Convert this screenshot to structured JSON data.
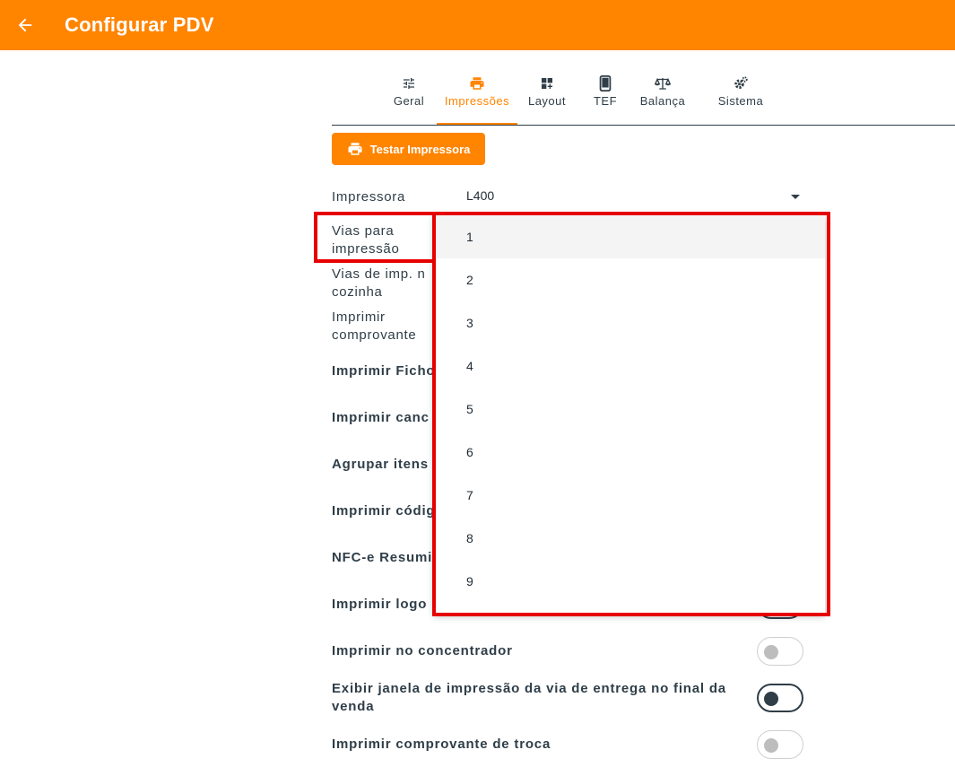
{
  "appbar": {
    "title": "Configurar PDV",
    "back_icon": "arrow-left-icon"
  },
  "tabs": [
    {
      "label": "Geral",
      "icon": "tune-icon"
    },
    {
      "label": "Impressões",
      "icon": "printer-icon",
      "active": true
    },
    {
      "label": "Layout",
      "icon": "dashboard-add-icon"
    },
    {
      "label": "TEF",
      "icon": "phone-icon"
    },
    {
      "label": "Balança",
      "icon": "scale-icon"
    },
    {
      "label": "Sistema",
      "icon": "gears-icon"
    }
  ],
  "test_button": {
    "label": "Testar Impressora",
    "icon": "printer-icon"
  },
  "fields": {
    "impressora": {
      "label": "Impressora",
      "value": "L400"
    },
    "vias": {
      "label_l1": "Vias para",
      "label_l2": "impressão"
    },
    "vias_cozinha": {
      "label_l1": "Vias de imp. n",
      "label_l2": "cozinha"
    },
    "comprovante": {
      "label_l1": "Imprimir",
      "label_l2": "comprovante"
    }
  },
  "switches": [
    {
      "label": "Imprimir Ficho"
    },
    {
      "label": "Imprimir canc"
    },
    {
      "label": "Agrupar itens"
    },
    {
      "label": "Imprimir códig"
    },
    {
      "label": "NFC-e Resumi"
    },
    {
      "label": "Imprimir logo",
      "on": true
    },
    {
      "label": "Imprimir no concentrador",
      "on": false
    },
    {
      "label_l1": "Exibir janela de impressão da via de entrega no final da",
      "label_l2": "venda",
      "on": true
    },
    {
      "label": "Imprimir comprovante de troca",
      "on": false
    }
  ],
  "dropdown": {
    "options": [
      "1",
      "2",
      "3",
      "4",
      "5",
      "6",
      "7",
      "8",
      "9"
    ],
    "highlighted": "1"
  },
  "colors": {
    "accent": "#ff8400",
    "text": "#2f3e48",
    "highlight_border": "#e60000"
  }
}
